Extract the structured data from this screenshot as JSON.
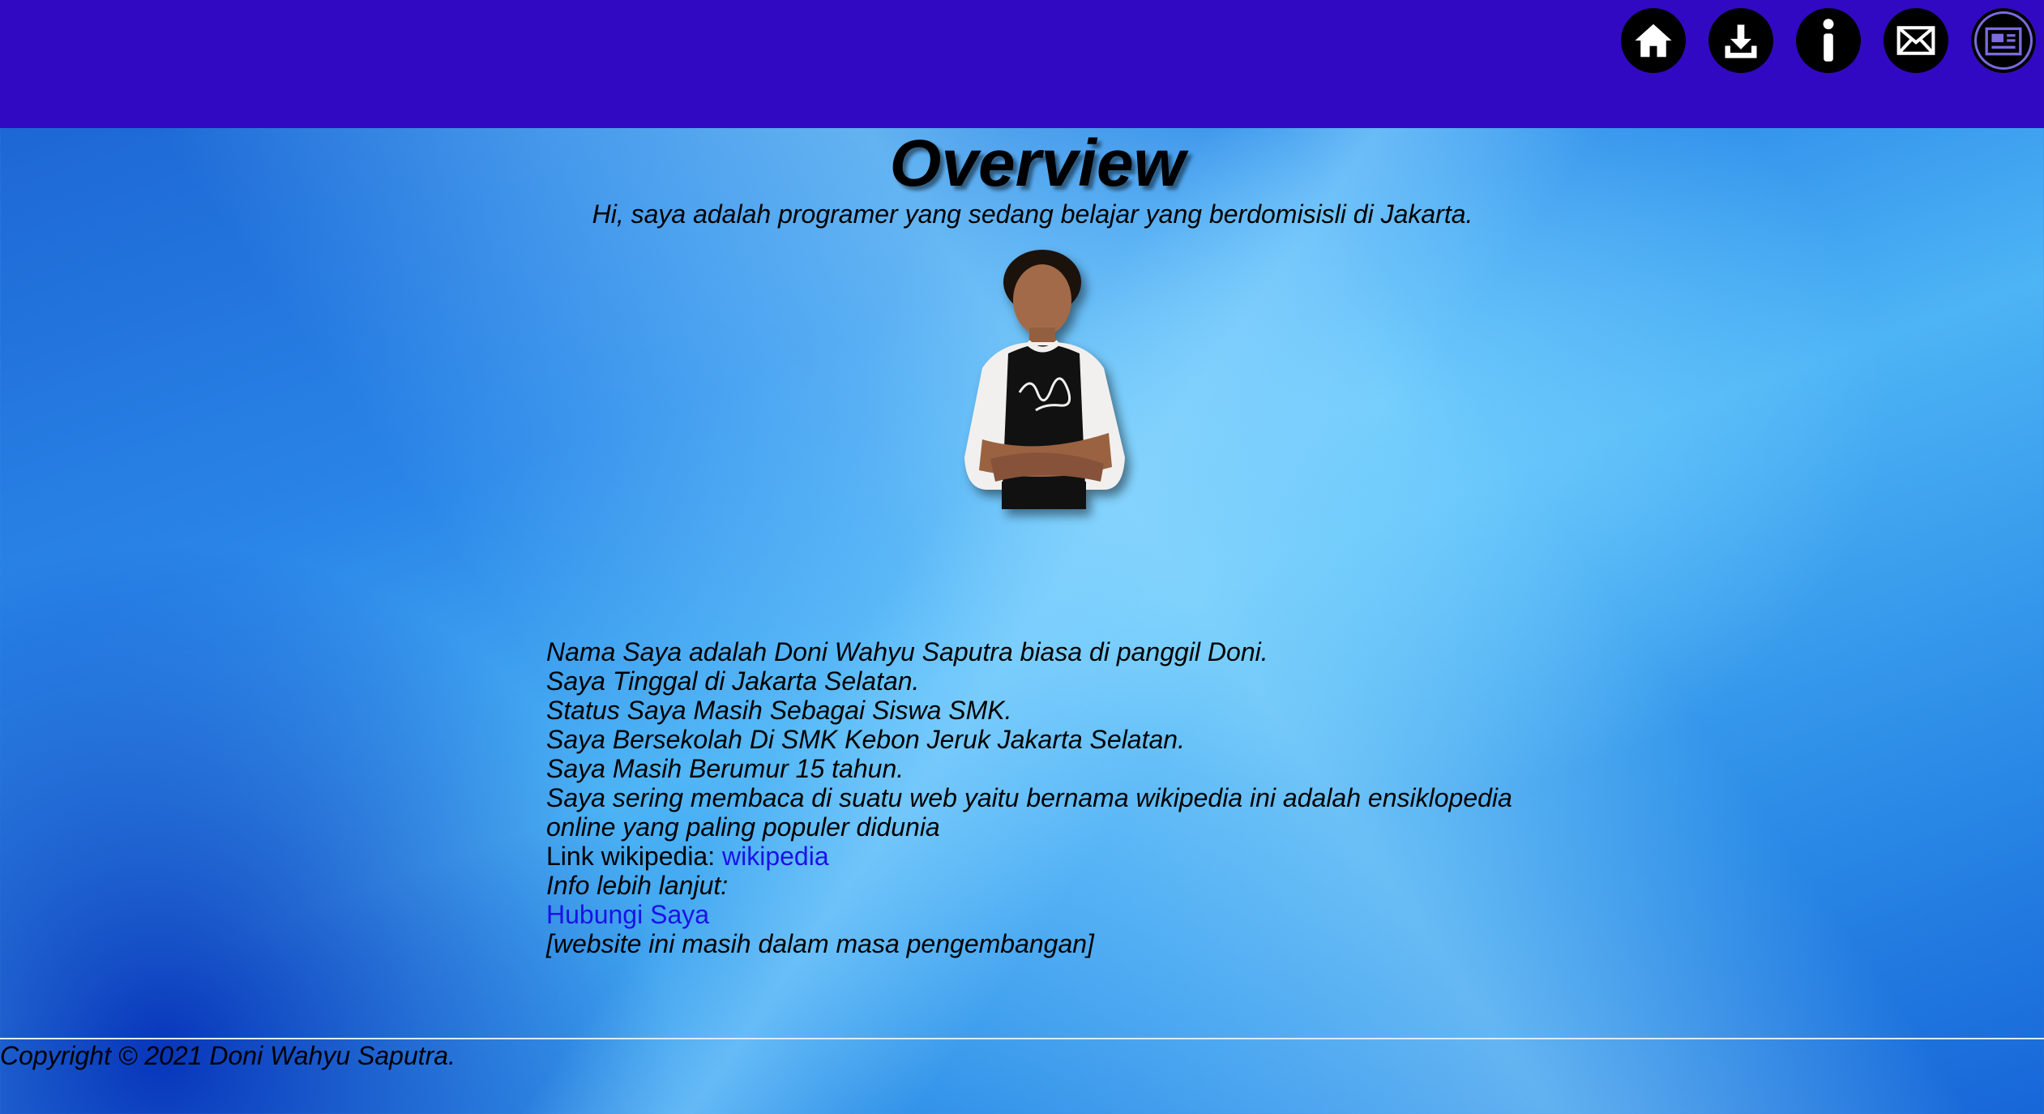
{
  "nav": {
    "items": [
      {
        "icon": "home-icon"
      },
      {
        "icon": "download-icon"
      },
      {
        "icon": "info-icon"
      },
      {
        "icon": "mail-icon"
      },
      {
        "icon": "news-icon"
      }
    ]
  },
  "header": {
    "title": "Overview",
    "subtitle": "Hi, saya adalah programer yang sedang belajar yang berdomisisli di Jakarta."
  },
  "about": {
    "lines": [
      "Nama Saya adalah Doni Wahyu Saputra biasa di panggil Doni.",
      "Saya Tinggal di Jakarta Selatan.",
      "Status Saya Masih Sebagai Siswa SMK.",
      "Saya Bersekolah Di SMK Kebon Jeruk Jakarta Selatan.",
      "Saya Masih Berumur 15 tahun.",
      "Saya sering membaca di suatu web yaitu bernama wikipedia ini adalah ensiklopedia online yang paling populer didunia"
    ],
    "wiki_label": "Link wikipedia: ",
    "wiki_link": "wikipedia",
    "more_info": "Info lebih lanjut:",
    "contact_link": "Hubungi Saya",
    "note": "[website ini masih dalam masa pengembangan]"
  },
  "footer": {
    "copyright": "Copyright © 2021 Doni Wahyu Saputra."
  },
  "colors": {
    "topbar": "#3209c2",
    "link": "#1a12e8"
  }
}
